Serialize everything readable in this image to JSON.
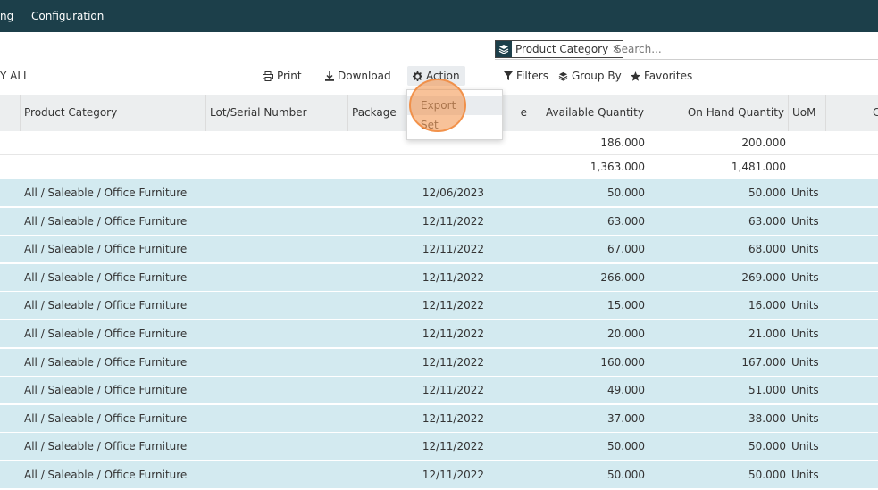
{
  "navbar": {
    "items": [
      "ng",
      "Configuration"
    ]
  },
  "control_panel": {
    "select_all_label": "Y ALL",
    "print_label": "Print",
    "download_label": "Download",
    "action_label": "Action",
    "filters_label": "Filters",
    "group_by_label": "Group By",
    "favorites_label": "Favorites",
    "search": {
      "facet_label": "Product Category",
      "facet_remove": "×",
      "placeholder": "Search..."
    }
  },
  "action_menu": {
    "items": [
      "Export",
      "Set"
    ]
  },
  "table": {
    "headers": {
      "product_category": "Product Category",
      "lot_serial": "Lot/Serial Number",
      "package": "Package",
      "date_suffix": "e",
      "available_qty": "Available Quantity",
      "on_hand_qty": "On Hand Quantity",
      "uom": "UoM",
      "extra": "C"
    },
    "group_rows": [
      {
        "available": "186.000",
        "on_hand": "200.000"
      },
      {
        "available": "1,363.000",
        "on_hand": "1,481.000"
      }
    ],
    "rows": [
      {
        "category": "All / Saleable / Office Furniture",
        "date": "12/06/2023",
        "available": "50.000",
        "on_hand": "50.000",
        "uom": "Units"
      },
      {
        "category": "All / Saleable / Office Furniture",
        "date": "12/11/2022",
        "available": "63.000",
        "on_hand": "63.000",
        "uom": "Units"
      },
      {
        "category": "All / Saleable / Office Furniture",
        "date": "12/11/2022",
        "available": "67.000",
        "on_hand": "68.000",
        "uom": "Units"
      },
      {
        "category": "All / Saleable / Office Furniture",
        "date": "12/11/2022",
        "available": "266.000",
        "on_hand": "269.000",
        "uom": "Units"
      },
      {
        "category": "All / Saleable / Office Furniture",
        "date": "12/11/2022",
        "available": "15.000",
        "on_hand": "16.000",
        "uom": "Units"
      },
      {
        "category": "All / Saleable / Office Furniture",
        "date": "12/11/2022",
        "available": "20.000",
        "on_hand": "21.000",
        "uom": "Units"
      },
      {
        "category": "All / Saleable / Office Furniture",
        "date": "12/11/2022",
        "available": "160.000",
        "on_hand": "167.000",
        "uom": "Units"
      },
      {
        "category": "All / Saleable / Office Furniture",
        "date": "12/11/2022",
        "available": "49.000",
        "on_hand": "51.000",
        "uom": "Units"
      },
      {
        "category": "All / Saleable / Office Furniture",
        "date": "12/11/2022",
        "available": "37.000",
        "on_hand": "38.000",
        "uom": "Units"
      },
      {
        "category": "All / Saleable / Office Furniture",
        "date": "12/11/2022",
        "available": "50.000",
        "on_hand": "50.000",
        "uom": "Units"
      },
      {
        "category": "All / Saleable / Office Furniture",
        "date": "12/11/2022",
        "available": "50.000",
        "on_hand": "50.000",
        "uom": "Units"
      }
    ]
  },
  "colors": {
    "navbar": "#1c3f4a",
    "row_highlight": "#d3eaf0",
    "click_indicator": "#f38f46"
  }
}
